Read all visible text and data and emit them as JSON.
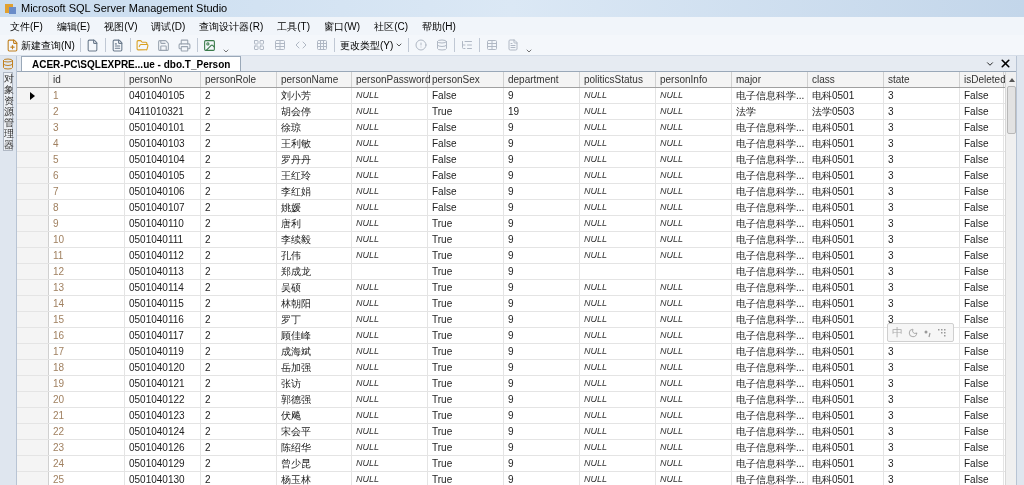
{
  "window": {
    "title": "Microsoft SQL Server Management Studio"
  },
  "menu": [
    "文件(F)",
    "编辑(E)",
    "视图(V)",
    "调试(D)",
    "查询设计器(R)",
    "工具(T)",
    "窗口(W)",
    "社区(C)",
    "帮助(H)"
  ],
  "toolbar": {
    "new_query": "新建查询(N)",
    "change_type": "更改类型(Y)"
  },
  "side_panel": {
    "label": "对象资源管理器"
  },
  "document_tab": {
    "title": "ACER-PC\\SQLEXPRE...ue - dbo.T_Person",
    "selected": true
  },
  "table": {
    "columns": [
      "id",
      "personNo",
      "personRole",
      "personName",
      "personPassword",
      "personSex",
      "department",
      "politicsStatus",
      "personInfo",
      "major",
      "class",
      "state",
      "isDeleted"
    ],
    "rows": [
      {
        "current": true,
        "cells": [
          "1",
          "0401040105",
          "2",
          "刘小芳",
          {
            "text": "NULL",
            "kind": "null"
          },
          "False",
          "9",
          {
            "text": "NULL",
            "kind": "null"
          },
          {
            "text": "NULL",
            "kind": "null"
          },
          "电子信息科学...",
          "电科0501",
          "3",
          "False"
        ]
      },
      {
        "current": false,
        "cells": [
          "2",
          "0411010321",
          "2",
          "胡会停",
          {
            "text": "NULL",
            "kind": "null"
          },
          "True",
          "19",
          {
            "text": "NULL",
            "kind": "null"
          },
          {
            "text": "NULL",
            "kind": "null"
          },
          "法学",
          "法学0503",
          "3",
          "False"
        ]
      },
      {
        "current": false,
        "cells": [
          "3",
          "0501040101",
          "2",
          "徐琼",
          {
            "text": "NULL",
            "kind": "null"
          },
          "False",
          "9",
          {
            "text": "NULL",
            "kind": "null"
          },
          {
            "text": "NULL",
            "kind": "null"
          },
          "电子信息科学...",
          "电科0501",
          "3",
          "False"
        ]
      },
      {
        "current": false,
        "cells": [
          "4",
          "0501040103",
          "2",
          "王利敏",
          {
            "text": "NULL",
            "kind": "null"
          },
          "False",
          "9",
          {
            "text": "NULL",
            "kind": "null"
          },
          {
            "text": "NULL",
            "kind": "null"
          },
          "电子信息科学...",
          "电科0501",
          "3",
          "False"
        ]
      },
      {
        "current": false,
        "cells": [
          "5",
          "0501040104",
          "2",
          "罗丹丹",
          {
            "text": "NULL",
            "kind": "null"
          },
          "False",
          "9",
          {
            "text": "NULL",
            "kind": "null"
          },
          {
            "text": "NULL",
            "kind": "null"
          },
          "电子信息科学...",
          "电科0501",
          "3",
          "False"
        ]
      },
      {
        "current": false,
        "cells": [
          "6",
          "0501040105",
          "2",
          "王红玲",
          {
            "text": "NULL",
            "kind": "null"
          },
          "False",
          "9",
          {
            "text": "NULL",
            "kind": "null"
          },
          {
            "text": "NULL",
            "kind": "null"
          },
          "电子信息科学...",
          "电科0501",
          "3",
          "False"
        ]
      },
      {
        "current": false,
        "cells": [
          "7",
          "0501040106",
          "2",
          "李红娟",
          {
            "text": "NULL",
            "kind": "null"
          },
          "False",
          "9",
          {
            "text": "NULL",
            "kind": "null"
          },
          {
            "text": "NULL",
            "kind": "null"
          },
          "电子信息科学...",
          "电科0501",
          "3",
          "False"
        ]
      },
      {
        "current": false,
        "cells": [
          "8",
          "0501040107",
          "2",
          "姚媛",
          {
            "text": "NULL",
            "kind": "null"
          },
          "False",
          "9",
          {
            "text": "NULL",
            "kind": "null"
          },
          {
            "text": "NULL",
            "kind": "null"
          },
          "电子信息科学...",
          "电科0501",
          "3",
          "False"
        ]
      },
      {
        "current": false,
        "cells": [
          "9",
          "0501040110",
          "2",
          "唐利",
          {
            "text": "NULL",
            "kind": "null"
          },
          "True",
          "9",
          {
            "text": "NULL",
            "kind": "null"
          },
          {
            "text": "NULL",
            "kind": "null"
          },
          "电子信息科学...",
          "电科0501",
          "3",
          "False"
        ]
      },
      {
        "current": false,
        "cells": [
          "10",
          "0501040111",
          "2",
          "李续毅",
          {
            "text": "NULL",
            "kind": "null"
          },
          "True",
          "9",
          {
            "text": "NULL",
            "kind": "null"
          },
          {
            "text": "NULL",
            "kind": "null"
          },
          "电子信息科学...",
          "电科0501",
          "3",
          "False"
        ]
      },
      {
        "current": false,
        "cells": [
          "11",
          "0501040112",
          "2",
          "孔伟",
          {
            "text": "NULL",
            "kind": "null"
          },
          "True",
          "9",
          {
            "text": "NULL",
            "kind": "null"
          },
          {
            "text": "NULL",
            "kind": "null"
          },
          "电子信息科学...",
          "电科0501",
          "3",
          "False"
        ]
      },
      {
        "current": false,
        "cells": [
          "12",
          "0501040113",
          "2",
          "郑成龙",
          null,
          "True",
          "9",
          null,
          null,
          "电子信息科学...",
          "电科0501",
          "3",
          "False"
        ]
      },
      {
        "current": false,
        "cells": [
          "13",
          "0501040114",
          "2",
          "吴硕",
          {
            "text": "NULL",
            "kind": "null"
          },
          "True",
          "9",
          {
            "text": "NULL",
            "kind": "null"
          },
          {
            "text": "NULL",
            "kind": "null"
          },
          "电子信息科学...",
          "电科0501",
          "3",
          "False"
        ]
      },
      {
        "current": false,
        "cells": [
          "14",
          "0501040115",
          "2",
          "林朝阳",
          {
            "text": "NULL",
            "kind": "null"
          },
          "True",
          "9",
          {
            "text": "NULL",
            "kind": "null"
          },
          {
            "text": "NULL",
            "kind": "null"
          },
          "电子信息科学...",
          "电科0501",
          "3",
          "False"
        ]
      },
      {
        "current": false,
        "cells": [
          "15",
          "0501040116",
          "2",
          "罗丁",
          {
            "text": "NULL",
            "kind": "null"
          },
          "True",
          "9",
          {
            "text": "NULL",
            "kind": "null"
          },
          {
            "text": "NULL",
            "kind": "null"
          },
          "电子信息科学...",
          "电科0501",
          "3",
          "False"
        ]
      },
      {
        "current": false,
        "cells": [
          "16",
          "0501040117",
          "2",
          "顾佳峰",
          {
            "text": "NULL",
            "kind": "null"
          },
          "True",
          "9",
          {
            "text": "NULL",
            "kind": "null"
          },
          {
            "text": "NULL",
            "kind": "null"
          },
          "电子信息科学...",
          "电科0501",
          null,
          "False"
        ]
      },
      {
        "current": false,
        "cells": [
          "17",
          "0501040119",
          "2",
          "成海斌",
          {
            "text": "NULL",
            "kind": "null"
          },
          "True",
          "9",
          {
            "text": "NULL",
            "kind": "null"
          },
          {
            "text": "NULL",
            "kind": "null"
          },
          "电子信息科学...",
          "电科0501",
          "3",
          "False"
        ]
      },
      {
        "current": false,
        "cells": [
          "18",
          "0501040120",
          "2",
          "岳加强",
          {
            "text": "NULL",
            "kind": "null"
          },
          "True",
          "9",
          {
            "text": "NULL",
            "kind": "null"
          },
          {
            "text": "NULL",
            "kind": "null"
          },
          "电子信息科学...",
          "电科0501",
          "3",
          "False"
        ]
      },
      {
        "current": false,
        "cells": [
          "19",
          "0501040121",
          "2",
          "张访",
          {
            "text": "NULL",
            "kind": "null"
          },
          "True",
          "9",
          {
            "text": "NULL",
            "kind": "null"
          },
          {
            "text": "NULL",
            "kind": "null"
          },
          "电子信息科学...",
          "电科0501",
          "3",
          "False"
        ]
      },
      {
        "current": false,
        "cells": [
          "20",
          "0501040122",
          "2",
          "郭德强",
          {
            "text": "NULL",
            "kind": "null"
          },
          "True",
          "9",
          {
            "text": "NULL",
            "kind": "null"
          },
          {
            "text": "NULL",
            "kind": "null"
          },
          "电子信息科学...",
          "电科0501",
          "3",
          "False"
        ]
      },
      {
        "current": false,
        "cells": [
          "21",
          "0501040123",
          "2",
          "伏飚",
          {
            "text": "NULL",
            "kind": "null"
          },
          "True",
          "9",
          {
            "text": "NULL",
            "kind": "null"
          },
          {
            "text": "NULL",
            "kind": "null"
          },
          "电子信息科学...",
          "电科0501",
          "3",
          "False"
        ]
      },
      {
        "current": false,
        "cells": [
          "22",
          "0501040124",
          "2",
          "宋会平",
          {
            "text": "NULL",
            "kind": "null"
          },
          "True",
          "9",
          {
            "text": "NULL",
            "kind": "null"
          },
          {
            "text": "NULL",
            "kind": "null"
          },
          "电子信息科学...",
          "电科0501",
          "3",
          "False"
        ]
      },
      {
        "current": false,
        "cells": [
          "23",
          "0501040126",
          "2",
          "陈绍华",
          {
            "text": "NULL",
            "kind": "null"
          },
          "True",
          "9",
          {
            "text": "NULL",
            "kind": "null"
          },
          {
            "text": "NULL",
            "kind": "null"
          },
          "电子信息科学...",
          "电科0501",
          "3",
          "False"
        ]
      },
      {
        "current": false,
        "cells": [
          "24",
          "0501040129",
          "2",
          "曾少昆",
          {
            "text": "NULL",
            "kind": "null"
          },
          "True",
          "9",
          {
            "text": "NULL",
            "kind": "null"
          },
          {
            "text": "NULL",
            "kind": "null"
          },
          "电子信息科学...",
          "电科0501",
          "3",
          "False"
        ]
      },
      {
        "current": false,
        "cells": [
          "25",
          "0501040130",
          "2",
          "杨玉林",
          {
            "text": "NULL",
            "kind": "null"
          },
          "True",
          "9",
          {
            "text": "NULL",
            "kind": "null"
          },
          {
            "text": "NULL",
            "kind": "null"
          },
          "电子信息科学...",
          "电科0501",
          "3",
          "False"
        ]
      }
    ]
  },
  "ime_toolbar": {
    "mode": "中"
  }
}
